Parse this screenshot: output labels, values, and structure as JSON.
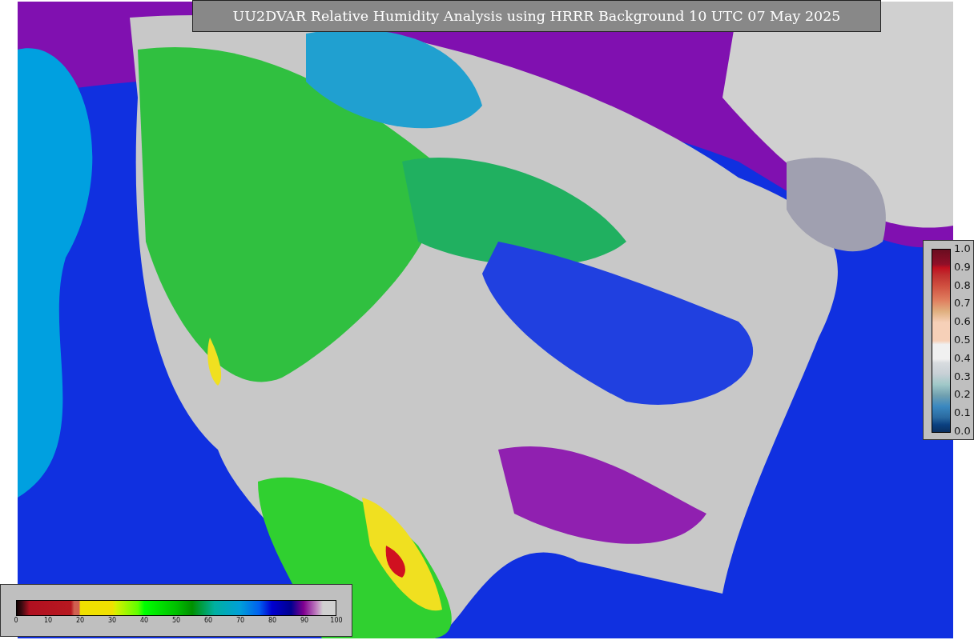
{
  "title": "UU2DVAR Relative Humidity Analysis using HRRR Background 10 UTC 07 May 2025",
  "humidity_colorbar": {
    "ticks": [
      "0",
      "10",
      "20",
      "30",
      "40",
      "50",
      "60",
      "70",
      "80",
      "90",
      "100"
    ]
  },
  "increment_colorbar": {
    "ticks": [
      "1.0",
      "0.9",
      "0.8",
      "0.7",
      "0.6",
      "0.5",
      "0.4",
      "0.3",
      "0.2",
      "0.1",
      "0.0"
    ]
  }
}
